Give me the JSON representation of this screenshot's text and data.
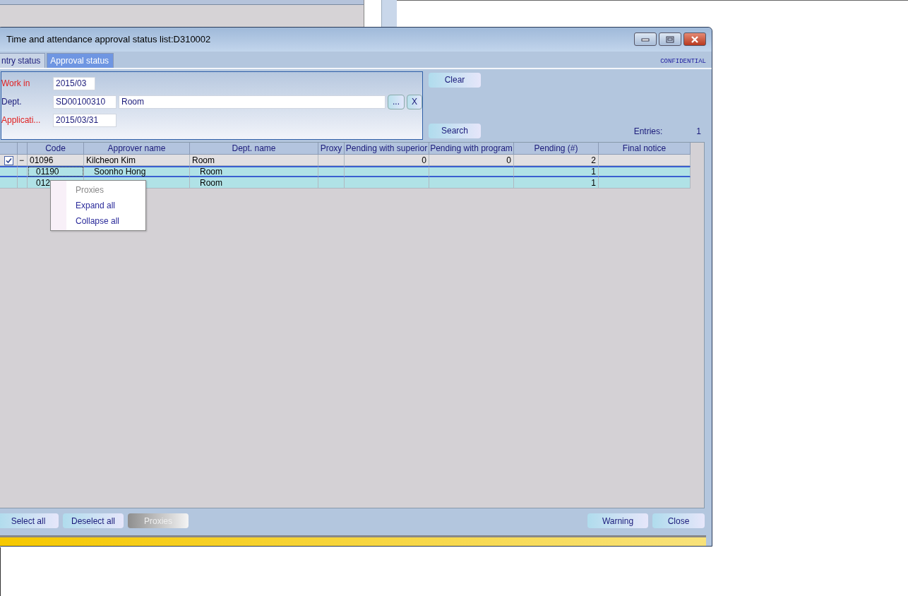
{
  "window": {
    "title": "Time and attendance approval status list:D310002"
  },
  "tabs": [
    {
      "label": "ntry status",
      "selected": false
    },
    {
      "label": "Approval status",
      "selected": true
    }
  ],
  "confidential": "CONFIDENTIAL",
  "form": {
    "fields": [
      {
        "label": "Work in",
        "required": true,
        "value": "2015/03"
      },
      {
        "label": "Dept.",
        "required": false,
        "value": "SD00100310",
        "name_value": "Room",
        "lookup": "...",
        "clear": "X"
      },
      {
        "label": "Applicati...",
        "required": true,
        "value": "2015/03/31"
      }
    ]
  },
  "clear_button": "Clear",
  "search_button": "Search",
  "entries_label": "Entries:",
  "entries_count": "1",
  "table": {
    "columns": [
      "",
      "",
      "Code",
      "Approver name",
      "Dept. name",
      "Proxy",
      "Pending with superior",
      "Pending with program",
      "Pending (#)",
      "Final notice"
    ],
    "rows": [
      {
        "checked": true,
        "expanded": true,
        "expander": "−",
        "code": "01096",
        "approver": "Kilcheon Kim",
        "dept": "Room",
        "proxy": "",
        "pending_superior": "0",
        "pending_program": "0",
        "pending": "2",
        "final_notice": "",
        "selected": false,
        "children": [
          {
            "code": "01190",
            "approver": "Soonho Hong",
            "dept": "Room",
            "pending": "1",
            "selected": true
          },
          {
            "code": "012",
            "dept": "Room",
            "pending": "1",
            "selected": false
          }
        ]
      }
    ]
  },
  "context_menu": [
    {
      "label": "Proxies",
      "disabled": true
    },
    {
      "label": "Expand all",
      "disabled": false
    },
    {
      "label": "Collapse all",
      "disabled": false
    }
  ],
  "footer_left": [
    {
      "label": "Select all",
      "disabled": false
    },
    {
      "label": "Deselect all",
      "disabled": false
    },
    {
      "label": "Proxies",
      "disabled": true
    }
  ],
  "footer_right": [
    {
      "label": "Warning",
      "disabled": false
    },
    {
      "label": "Close",
      "disabled": false
    }
  ]
}
